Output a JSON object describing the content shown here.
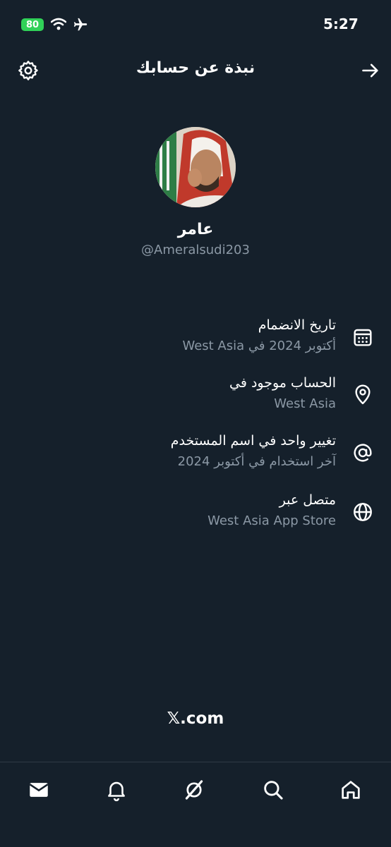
{
  "status_bar": {
    "battery": "80",
    "time": "5:27"
  },
  "header": {
    "title": "نبذة عن حسابك"
  },
  "profile": {
    "display_name": "عامر",
    "handle": "@Ameralsudi203"
  },
  "info_rows": [
    {
      "icon": "calendar-icon",
      "title": "تاريخ الانضمام",
      "subtitle": "أكتوبر 2024 في West Asia"
    },
    {
      "icon": "location-pin-icon",
      "title": "الحساب موجود في",
      "subtitle": "West Asia"
    },
    {
      "icon": "at-sign-icon",
      "title": "تغيير واحد في اسم المستخدم",
      "subtitle": "آخر استخدام في أكتوبر 2024"
    },
    {
      "icon": "globe-icon",
      "title": "متصل عبر",
      "subtitle": "West Asia App Store"
    }
  ],
  "footer": {
    "brand": "𝕏.com"
  },
  "bottom_nav": [
    "mail-icon",
    "bell-icon",
    "grok-icon",
    "search-icon",
    "home-icon"
  ]
}
